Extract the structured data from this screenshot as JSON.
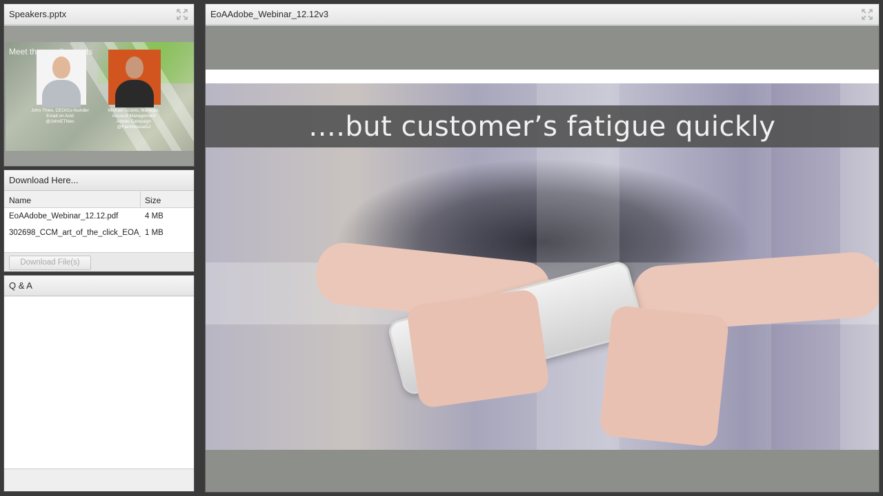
{
  "speakers_pod": {
    "title": "Speakers.pptx",
    "thumbnail": {
      "heading": "Meet the email experts",
      "speaker1_caption": "John Thies, CEO/Co-founder\nEmail on Acid\n@JohnEThies",
      "speaker2_caption": "Michael Sciano, Manager,\nAccount Management\nAdobe Campaign\n@FarmHouseDJ"
    }
  },
  "files_pod": {
    "title": "Download Here...",
    "columns": {
      "name": "Name",
      "size": "Size"
    },
    "rows": [
      {
        "name": "EoAAdobe_Webinar_12.12.pdf",
        "size": "4 MB"
      },
      {
        "name": "302698_CCM_art_of_the_click_EOA_",
        "size": "1 MB"
      }
    ],
    "download_button": "Download File(s)"
  },
  "qa_pod": {
    "title": "Q & A"
  },
  "share_pod": {
    "title": "EoAAdobe_Webinar_12.12v3",
    "slide_caption": "....but customer’s fatigue quickly"
  },
  "icons": {
    "fullscreen": "fullscreen-icon"
  }
}
